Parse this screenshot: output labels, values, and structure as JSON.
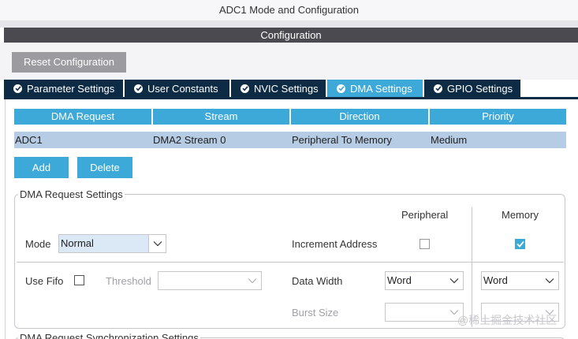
{
  "window": {
    "title": "ADC1 Mode and Configuration"
  },
  "config": {
    "header": "Configuration",
    "reset_label": "Reset Configuration"
  },
  "tabs": [
    {
      "label": "Parameter Settings"
    },
    {
      "label": "User Constants"
    },
    {
      "label": "NVIC Settings"
    },
    {
      "label": "DMA Settings"
    },
    {
      "label": "GPIO Settings"
    }
  ],
  "dma_table": {
    "columns": [
      "DMA Request",
      "Stream",
      "Direction",
      "Priority"
    ],
    "rows": [
      {
        "request": "ADC1",
        "stream": "DMA2 Stream 0",
        "direction": "Peripheral To Memory",
        "priority": "Medium"
      }
    ]
  },
  "actions": {
    "add_label": "Add",
    "delete_label": "Delete"
  },
  "request_settings": {
    "title": "DMA Request Settings",
    "peripheral_header": "Peripheral",
    "memory_header": "Memory",
    "mode_label": "Mode",
    "mode_value": "Normal",
    "increment_label": "Increment Address",
    "increment_peripheral_checked": false,
    "increment_memory_checked": true,
    "use_fifo_label": "Use Fifo",
    "use_fifo_checked": false,
    "threshold_label": "Threshold",
    "threshold_value": "",
    "data_width_label": "Data Width",
    "data_width_peripheral": "Word",
    "data_width_memory": "Word",
    "burst_label": "Burst Size",
    "burst_peripheral": "",
    "burst_memory": ""
  },
  "sync_settings": {
    "title": "DMA Request Synchronization Settings"
  },
  "watermark": "@稀土掘金技术社区",
  "colors": {
    "accent": "#3ca9d8",
    "tab_dark": "#0d2b45",
    "row_selected": "#b5cce4",
    "header_dark": "#4a4a50"
  }
}
